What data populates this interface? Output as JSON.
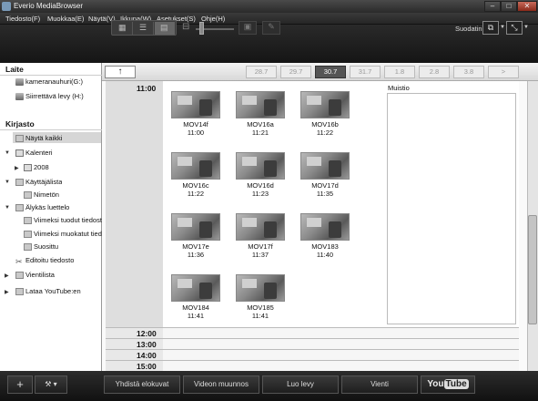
{
  "window": {
    "title": "Everio MediaBrowser"
  },
  "menu": [
    "Tiedosto(F)",
    "Muokkaa(E)",
    "Näytä(V)",
    "Ikkuna(W)",
    "Asetukset(S)",
    "Ohje(H)"
  ],
  "toolbar": {
    "filter_label": "Suodatin"
  },
  "left": {
    "device_header": "Laite",
    "devices": [
      "kameranauhuri(G:)",
      "Siirrettävä levy (H:)"
    ],
    "library_header": "Kirjasto",
    "library": {
      "show_all": "Näytä kaikki",
      "calendar": "Kalenteri",
      "year": "2008",
      "users": "Käyttäjälista",
      "unnamed": "Nimetön",
      "smart": "Älykäs luettelo",
      "recent_imported": "Viimeksi tuodut tiedost",
      "recent_edited": "Viimeksi muokatut tied",
      "favorite": "Suosittu",
      "edited_file": "Editoitu tiedosto",
      "export_list": "Vientilista",
      "youtube_upload": "Lataa YouTube:en"
    }
  },
  "datebar": {
    "up_label": "↑",
    "dates": [
      "28.7",
      "29.7",
      "30.7",
      "31.7",
      "1.8",
      "2.8",
      "3.8"
    ],
    "active_index": 2,
    "next_label": ">"
  },
  "main": {
    "first_hour": "11:00",
    "clips": [
      {
        "name": "MOV14f",
        "time": "11:00"
      },
      {
        "name": "MOV16a",
        "time": "11:21"
      },
      {
        "name": "MOV16b",
        "time": "11:22"
      },
      {
        "name": "MOV16c",
        "time": "11:22"
      },
      {
        "name": "MOV16d",
        "time": "11:23"
      },
      {
        "name": "MOV17d",
        "time": "11:35"
      },
      {
        "name": "MOV17e",
        "time": "11:36"
      },
      {
        "name": "MOV17f",
        "time": "11:37"
      },
      {
        "name": "MOV183",
        "time": "11:40"
      },
      {
        "name": "MOV184",
        "time": "11:41"
      },
      {
        "name": "MOV185",
        "time": "11:41"
      }
    ],
    "later_hours": [
      "12:00",
      "13:00",
      "14:00",
      "15:00"
    ],
    "memo_label": "Muistio"
  },
  "bottom": {
    "add": "+",
    "tools": "⚒ ▾",
    "merge_movies": "Yhdistä elokuvat",
    "video_convert": "Videon muunnos",
    "create_disc": "Luo levy",
    "export": "Vienti",
    "youtube_you": "You",
    "youtube_tube": "Tube"
  },
  "colors": {
    "selected_date_bg": "#555555",
    "chrome_dark": "#1a1a1a"
  }
}
